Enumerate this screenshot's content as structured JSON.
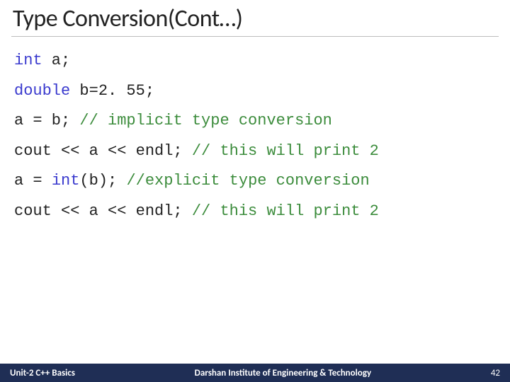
{
  "title": "Type Conversion(Cont…)",
  "code": {
    "l1": {
      "kw": "int",
      "rest": " a;"
    },
    "l2": {
      "kw": "double",
      "rest": " b=2. 55;"
    },
    "l3": {
      "text": "a = b; ",
      "comment": "// implicit type conversion"
    },
    "l4": {
      "text": "cout << a << endl; ",
      "comment": "// this will print 2"
    },
    "l5": {
      "pre": "a = ",
      "kw": "int",
      "post": "(b); ",
      "comment": "//explicit type conversion"
    },
    "l6": {
      "text": "cout << a << endl; ",
      "comment": "// this will print 2"
    }
  },
  "footer": {
    "left": "Unit-2 C++ Basics",
    "center": "Darshan Institute of Engineering & Technology",
    "right": "42"
  }
}
